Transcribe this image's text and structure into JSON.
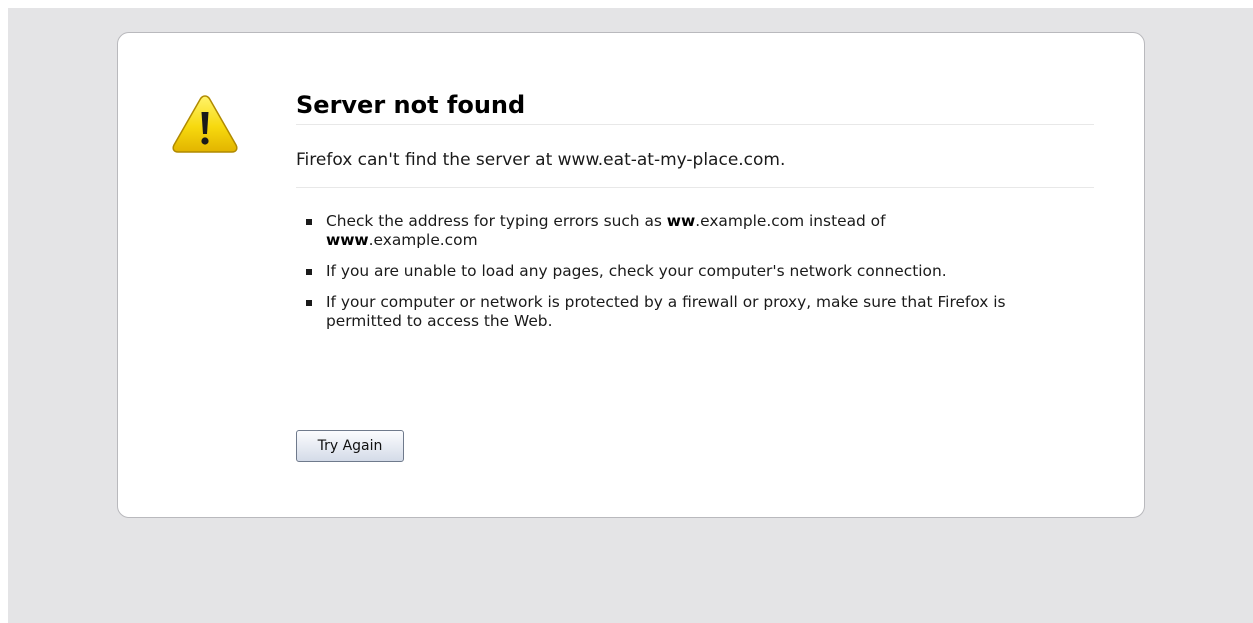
{
  "error": {
    "title": "Server not found",
    "short_desc": "Firefox can't find the server at www.eat-at-my-place.com.",
    "tips": [
      {
        "parts": [
          {
            "text": "Check the address for typing errors such as "
          },
          {
            "text": "ww",
            "bold": true
          },
          {
            "text": ".example.com instead of "
          },
          {
            "text": "www",
            "bold": true
          },
          {
            "text": ".example.com"
          }
        ]
      },
      {
        "parts": [
          {
            "text": "If you are unable to load any pages, check your computer's network connection."
          }
        ]
      },
      {
        "parts": [
          {
            "text": "If your computer or network is protected by a firewall or proxy, make sure that Firefox is permitted to access the Web."
          }
        ]
      }
    ],
    "try_again_label": "Try Again",
    "icon": "warning-icon"
  },
  "colors": {
    "page_background": "#e4e4e6",
    "card_background": "#ffffff",
    "warning_yellow": "#f5d20a"
  }
}
